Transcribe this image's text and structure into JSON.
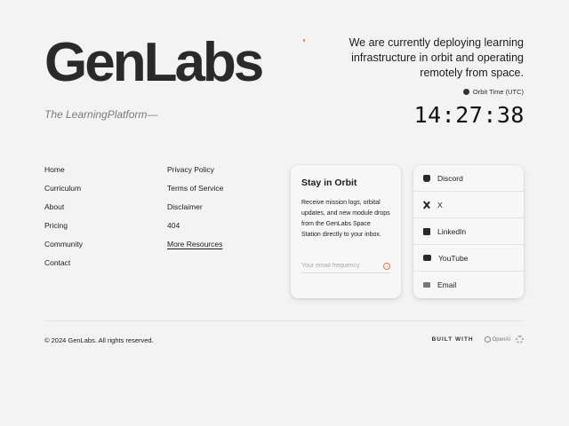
{
  "brand": {
    "logo": "GenLabs",
    "tagline": "The LearningPlatform—"
  },
  "hero": {
    "statement": "We are currently deploying learning infrastructure in orbit and operating remotely from space.",
    "orbit_label": "Orbit Time (UTC)",
    "orbit_time": "14:27:38"
  },
  "nav": {
    "left": [
      "Home",
      "Curriculum",
      "About",
      "Pricing",
      "Community",
      "Contact"
    ],
    "right": [
      "Privacy Policy",
      "Terms of Service",
      "Disclaimer",
      "404",
      "More Resources"
    ]
  },
  "newsletter": {
    "title": "Stay in Orbit",
    "description": "Receive mission logs, orbital updates, and new module drops from the GenLabs Space Station directly to your inbox.",
    "placeholder": "Your email frequency"
  },
  "social": {
    "items": [
      {
        "label": "Discord",
        "icon": "discord-icon"
      },
      {
        "label": "X",
        "icon": "x-icon"
      },
      {
        "label": "LinkedIn",
        "icon": "linkedin-icon"
      },
      {
        "label": "YouTube",
        "icon": "youtube-icon"
      },
      {
        "label": "Email",
        "icon": "email-icon"
      }
    ]
  },
  "footer": {
    "copyright": "© 2024 GenLabs. All rights reserved.",
    "built_with": "BUILT WITH",
    "built_with_brand": "OpenAI"
  },
  "colors": {
    "background": "#f3f3f3",
    "accent": "#e07a3e",
    "text": "#1c1c1c"
  }
}
